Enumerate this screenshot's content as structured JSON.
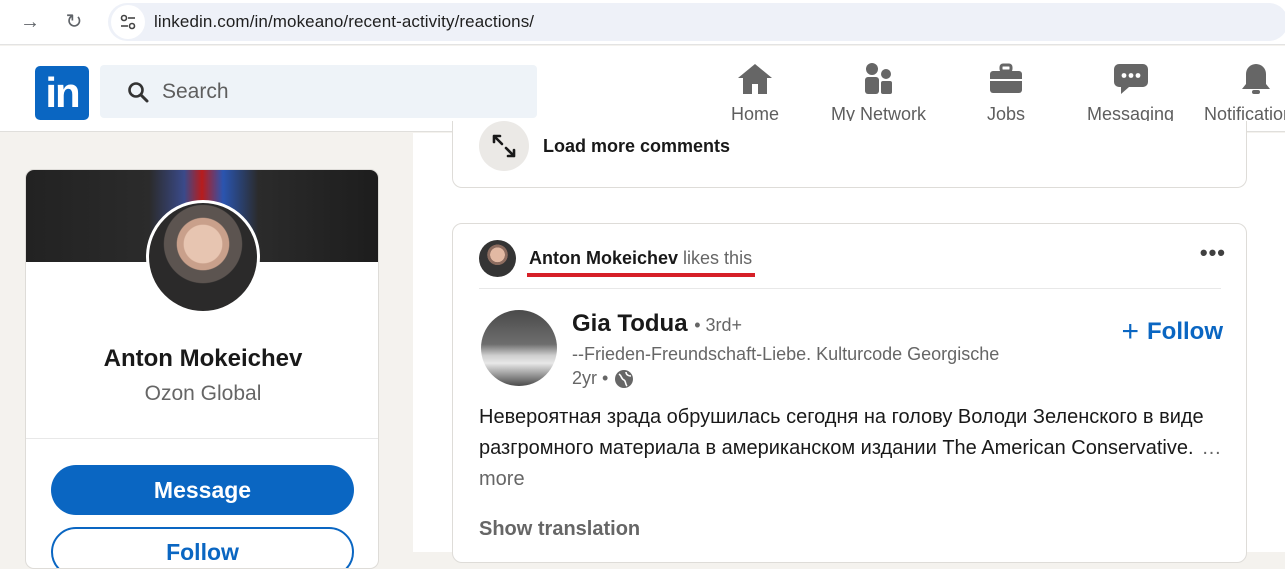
{
  "browser": {
    "url": "linkedin.com/in/mokeano/recent-activity/reactions/"
  },
  "header": {
    "logo_text": "in",
    "search_placeholder": "Search",
    "nav": [
      {
        "label": "Home",
        "icon": "home-icon"
      },
      {
        "label": "My Network",
        "icon": "my-network-icon"
      },
      {
        "label": "Jobs",
        "icon": "jobs-icon"
      },
      {
        "label": "Messaging",
        "icon": "messaging-icon"
      },
      {
        "label": "Notifications",
        "icon": "notifications-icon"
      }
    ],
    "accent_color": "#0a66c2"
  },
  "profile": {
    "name": "Anton Mokeichev",
    "company": "Ozon Global",
    "message_label": "Message",
    "follow_label": "Follow"
  },
  "feed": {
    "load_more_label": "Load more comments",
    "post": {
      "reactor_name": "Anton Mokeichev",
      "reaction_verb": "likes this",
      "author_name": "Gia Todua",
      "author_degree": "• 3rd+",
      "author_headline": "--Frieden-Freundschaft-Liebe. Kulturcode Georgische",
      "post_age": "2yr •",
      "follow_label": "Follow",
      "body": "Невероятная зрада обрушилась сегодня на голову Володи Зеленского в виде разгромного материала в американском издании The American Conservative.",
      "see_more_label": "…more",
      "show_translation_label": "Show translation"
    }
  }
}
